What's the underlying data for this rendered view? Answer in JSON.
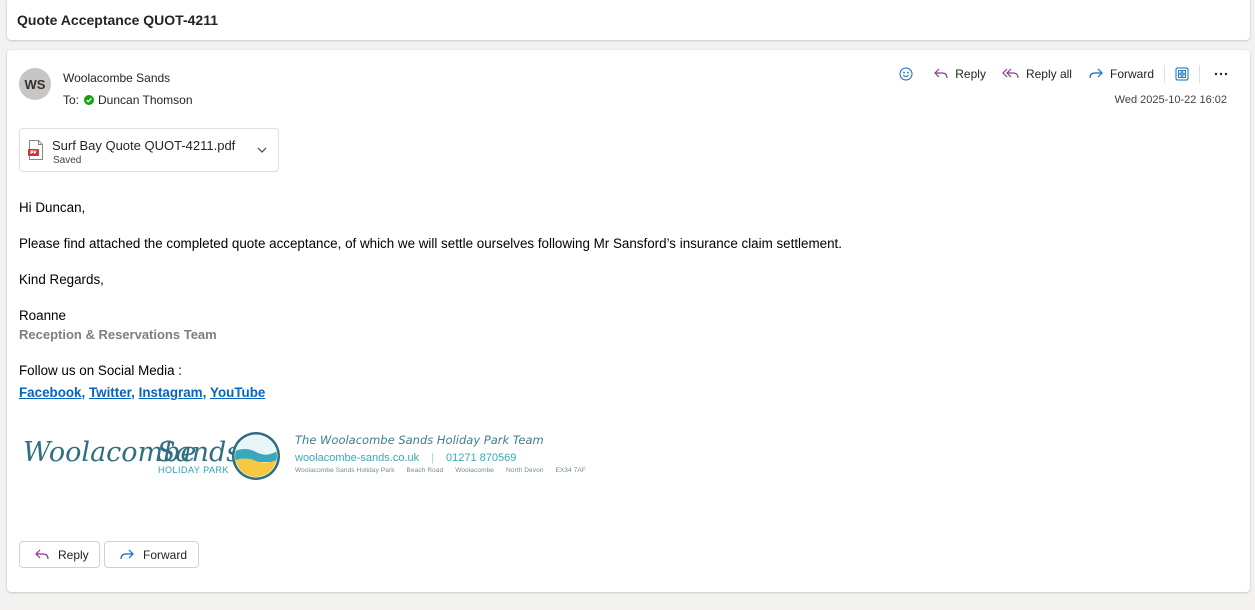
{
  "subject": "Quote Acceptance QUOT-4211",
  "sender": {
    "initials": "WS",
    "name": "Woolacombe Sands",
    "to_label": "To:",
    "recipient": "Duncan Thomson"
  },
  "actions": {
    "reply": "Reply",
    "reply_all": "Reply all",
    "forward": "Forward"
  },
  "date": "Wed 2025-10-22 16:02",
  "attachment": {
    "filename": "Surf Bay Quote QUOT-4211.pdf",
    "status": "Saved"
  },
  "body": {
    "greeting": "Hi Duncan,",
    "paragraph": "Please find attached the completed quote acceptance, of which we will settle ourselves following Mr Sansford’s insurance claim settlement.",
    "closing": "Kind Regards,",
    "signer": "Roanne",
    "team": "Reception & Reservations Team",
    "follow": "Follow us on Social Media :",
    "social": {
      "facebook": "Facebook",
      "twitter": "Twitter",
      "instagram": "Instagram,",
      "youtube": "YouTube"
    }
  },
  "signature": {
    "logo_word1": "Woolacombe",
    "logo_word2": "Sands",
    "logo_sub": "HOLIDAY PARK",
    "team_line": "The Woolacombe Sands Holiday Park Team",
    "website": "woolacombe-sands.co.uk",
    "phone": "01271 870569",
    "address": [
      "Woolacombe Sands Holiday Park",
      "Beach Road",
      "Woolacombe",
      "North Devon",
      "EX34 7AF"
    ]
  },
  "bottom": {
    "reply": "Reply",
    "forward": "Forward"
  },
  "colors": {
    "accent": "#0f6cbd",
    "reply_icon": "#8a3b8f",
    "presence": "#13a10e",
    "link": "#0563c1",
    "team_gray": "#7f7f7f"
  }
}
